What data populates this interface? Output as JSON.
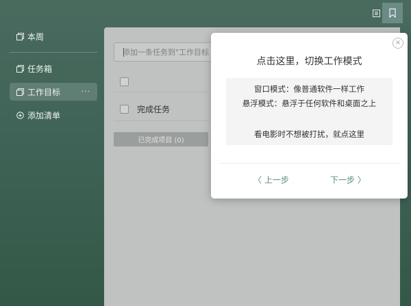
{
  "sidebar": {
    "items": [
      {
        "label": "本周"
      },
      {
        "label": "任务箱"
      },
      {
        "label": "工作目标",
        "more": "···"
      },
      {
        "label": "添加清单"
      }
    ]
  },
  "main": {
    "add_placeholder": "添加一条任务到\"工作目标",
    "task_done_label": "完成任务",
    "completed_button": "已完成项目 (0)"
  },
  "popup": {
    "title": "点击这里，切换工作模式",
    "line1": "窗口模式：像普通软件一样工作",
    "line2": "悬浮模式：悬浮于任何软件和桌面之上",
    "line3": "看电影时不想被打扰，就点这里",
    "prev": "〈 上一步",
    "next": "下一步 〉",
    "close": "×"
  },
  "colors": {
    "accent": "#5e8c7a",
    "sidebar_bg": "#3f6457",
    "highlight": "#6c8b86"
  },
  "icons": [
    "list-icon",
    "inbox-icon",
    "goal-icon",
    "plus-circle-icon",
    "notebook-icon",
    "bookmark-icon",
    "close-icon"
  ]
}
